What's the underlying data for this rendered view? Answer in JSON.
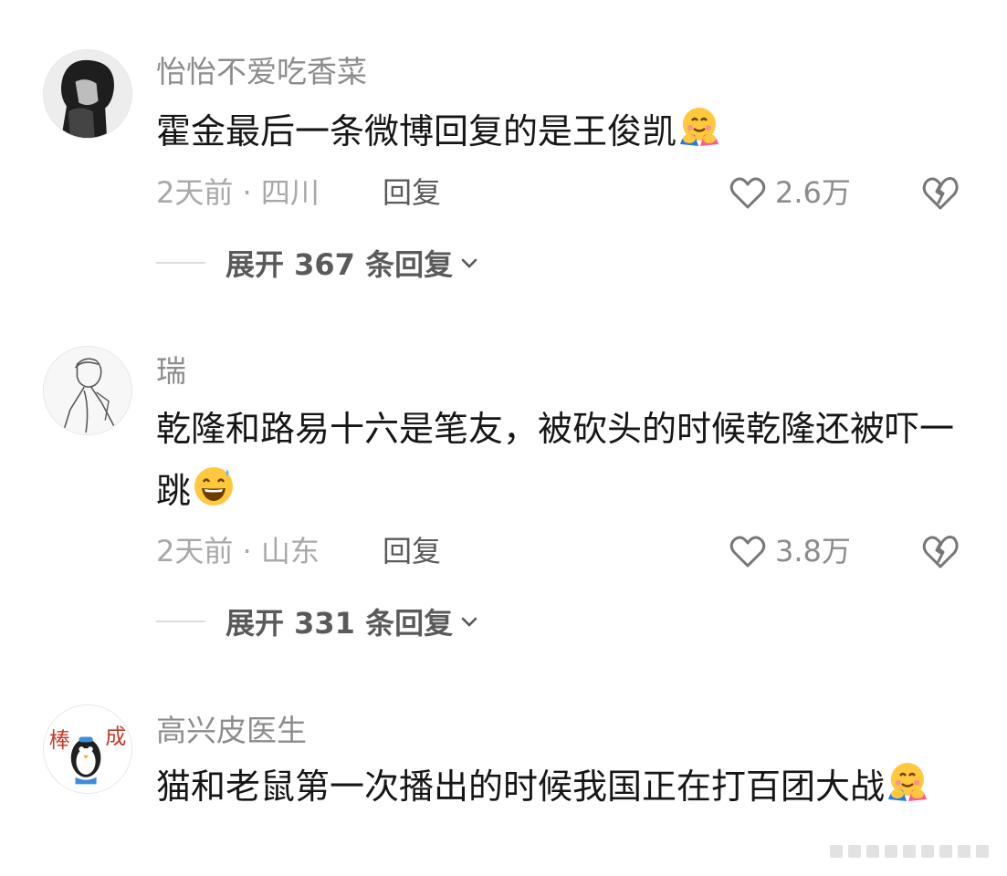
{
  "comments": [
    {
      "username": "怡怡不爱吃香菜",
      "text": "霍金最后一条微博回复的是王俊凯",
      "emoji": "hugging-face-icon",
      "time_location": "2天前 · 四川",
      "reply_label": "回复",
      "likes": "2.6万",
      "expand_label": "展开 367 条回复"
    },
    {
      "username": "瑞",
      "text": "乾隆和路易十六是笔友，被砍头的时候乾隆还被吓一跳",
      "emoji": "grinning-sweat-face-icon",
      "time_location": "2天前 · 山东",
      "reply_label": "回复",
      "likes": "3.8万",
      "expand_label": "展开 331 条回复"
    },
    {
      "username": "高兴皮医生",
      "text": "猫和老鼠第一次播出的时候我国正在打百团大战",
      "emoji": "hugging-face-icon",
      "avatar_text": "棒 成"
    }
  ],
  "colors": {
    "username": "#8c8c8c",
    "content": "#161616",
    "meta": "#a8a8a8",
    "action": "#5a5a5a"
  }
}
